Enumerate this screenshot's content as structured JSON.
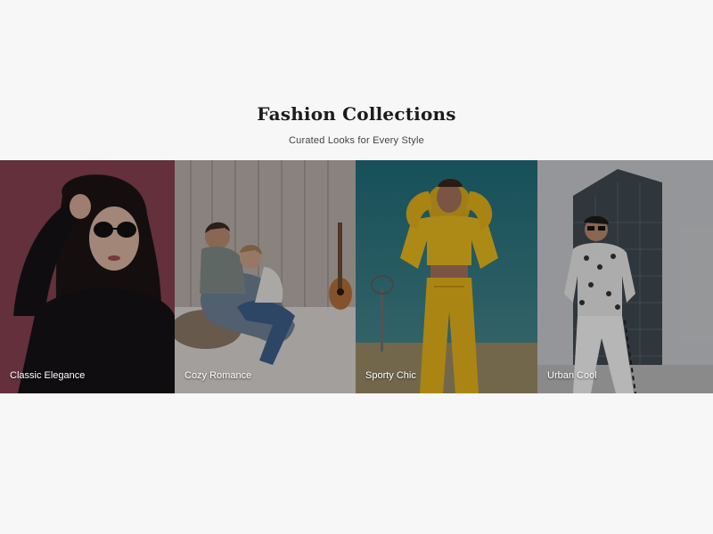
{
  "header": {
    "title": "Fashion Collections",
    "subtitle": "Curated Looks for Every Style"
  },
  "collections": [
    {
      "label": "Classic Elegance",
      "icon": "woman-portrait-sunglasses"
    },
    {
      "label": "Cozy Romance",
      "icon": "couple-on-floor-guitar"
    },
    {
      "label": "Sporty Chic",
      "icon": "woman-yellow-tracksuit"
    },
    {
      "label": "Urban Cool",
      "icon": "man-city-building"
    }
  ],
  "colors": {
    "background": "#f7f7f7",
    "title": "#1c1c1c",
    "label": "#ffffff"
  }
}
